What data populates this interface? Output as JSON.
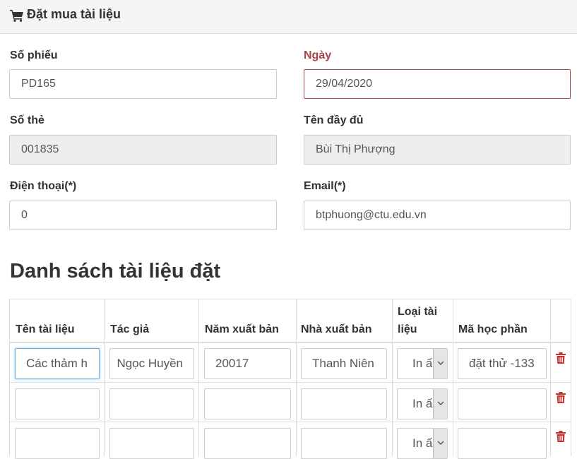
{
  "panel": {
    "title": "Đặt mua tài liệu",
    "icon": "shopping-cart-icon"
  },
  "form": {
    "so_phieu_label": "Số phiếu",
    "so_phieu_value": "PD165",
    "ngay_label": "Ngày",
    "ngay_value": "29/04/2020",
    "so_the_label": "Số thẻ",
    "so_the_value": "001835",
    "ten_label": "Tên đầy đủ",
    "ten_value": "Bùi Thị Phượng",
    "dien_thoai_label": "Điện thoại(*)",
    "dien_thoai_value": "0",
    "email_label": "Email(*)",
    "email_value": "btphuong@ctu.edu.vn"
  },
  "section": {
    "title": "Danh sách tài liệu đặt"
  },
  "table": {
    "headers": {
      "ten_tai_lieu": "Tên tài liệu",
      "tac_gia": "Tác giả",
      "nam_xuat_ban": "Năm xuất bản",
      "nha_xuat_ban": "Nhà xuất bản",
      "loai_tai_lieu_1": "Loại tài",
      "loai_tai_lieu_2": "liệu",
      "ma_hoc_phan": "Mã học phần"
    },
    "rows": [
      {
        "ten_tai_lieu": "Các thảm h",
        "tac_gia": "Ngọc Huyền",
        "nam_xuat_ban": "20017",
        "nha_xuat_ban": "Thanh Niên",
        "loai_tai_lieu": "In ấ",
        "ma_hoc_phan": "133- đặt thử"
      },
      {
        "ten_tai_lieu": "",
        "tac_gia": "",
        "nam_xuat_ban": "",
        "nha_xuat_ban": "",
        "loai_tai_lieu": "In ấ",
        "ma_hoc_phan": ""
      },
      {
        "ten_tai_lieu": "",
        "tac_gia": "",
        "nam_xuat_ban": "",
        "nha_xuat_ban": "",
        "loai_tai_lieu": "In ấ",
        "ma_hoc_phan": ""
      }
    ],
    "delete_icon": "trash-icon"
  },
  "colors": {
    "error": "#a94442",
    "delete": "#c9302c",
    "focus": "#66afe9",
    "readonly_bg": "#eeeeee",
    "heading_bg": "#f5f5f5"
  }
}
